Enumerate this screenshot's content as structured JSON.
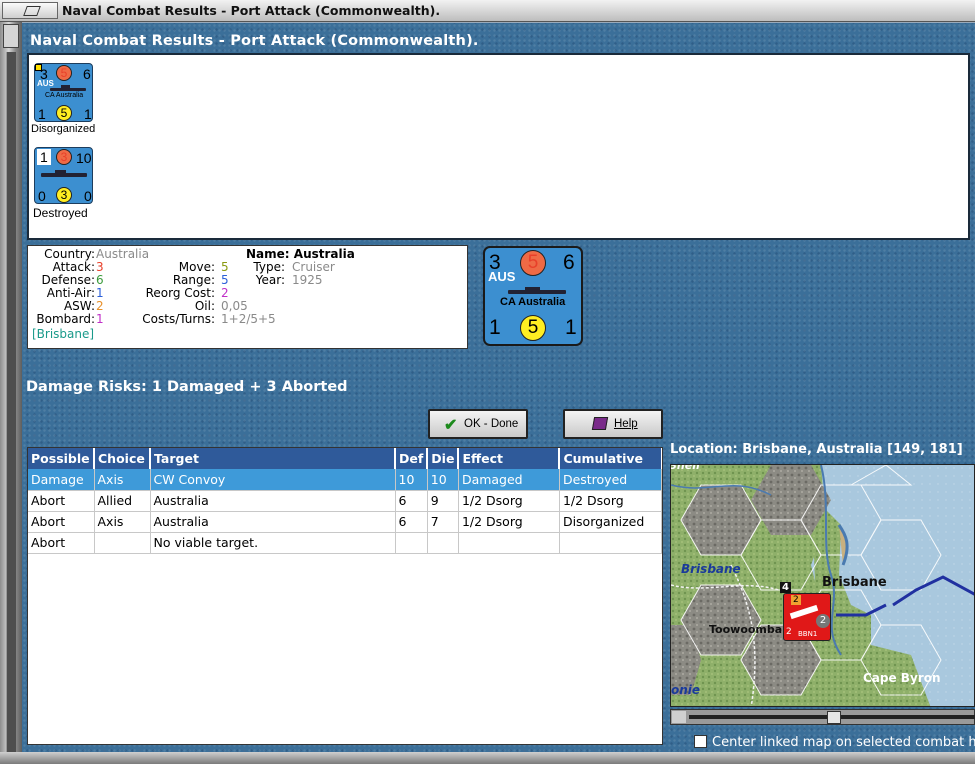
{
  "window": {
    "title": "Naval Combat Results - Port Attack (Commonwealth)."
  },
  "heading": "Naval Combat Results - Port Attack (Commonwealth).",
  "units": [
    {
      "nation": "AUS",
      "name": "CA Australia",
      "attack": "3",
      "defense_circle": "5",
      "range": "6",
      "bottom_left": "1",
      "bottom_circle": "5",
      "bottom_right": "1",
      "status": "Disorganized"
    },
    {
      "attack": "1",
      "defense_circle": "3",
      "range": "10",
      "bottom_left": "0",
      "bottom_circle": "3",
      "bottom_right": "0",
      "status": "Destroyed"
    }
  ],
  "info": {
    "country_label": "Country:",
    "country": "Australia",
    "attack_label": "Attack:",
    "attack": "3",
    "defense_label": "Defense:",
    "defense": "6",
    "antiair_label": "Anti-Air:",
    "antiair": "1",
    "asw_label": "ASW:",
    "asw": "2",
    "bombard_label": "Bombard:",
    "bombard": "1",
    "location": "[Brisbane]",
    "move_label": "Move:",
    "move": "5",
    "range_label": "Range:",
    "range": "5",
    "reorg_label": "Reorg Cost:",
    "reorg": "2",
    "oil_label": "Oil:",
    "oil": "0,05",
    "costs_label": "Costs/Turns:",
    "costs": "1+2/5+5",
    "name_label": "Name:",
    "name": "Australia",
    "type_label": "Type:",
    "type": "Cruiser",
    "year_label": "Year:",
    "year": "1925"
  },
  "big_counter": {
    "attack": "3",
    "defense_circle": "5",
    "range": "6",
    "nation": "AUS",
    "name": "CA Australia",
    "bottom_left": "1",
    "bottom_circle": "5",
    "bottom_right": "1"
  },
  "damage_risks": "Damage Risks: 1 Damaged + 3 Aborted",
  "buttons": {
    "ok": "OK - Done",
    "help": "Help"
  },
  "table": {
    "headers": [
      "Possible",
      "Choice",
      "Target",
      "Def",
      "Die",
      "Effect",
      "Cumulative"
    ],
    "rows": [
      [
        "Damage",
        "Axis",
        "CW Convoy",
        "10",
        "10",
        "Damaged",
        "Destroyed"
      ],
      [
        "Abort",
        "Allied",
        "Australia",
        "6",
        "9",
        "1/2 Dsorg",
        "1/2 Dsorg"
      ],
      [
        "Abort",
        "Axis",
        "Australia",
        "6",
        "7",
        "1/2 Dsorg",
        "Disorganized"
      ],
      [
        "Abort",
        "",
        "No viable target.",
        "",
        "",
        "",
        ""
      ]
    ]
  },
  "location": "Location:  Brisbane, Australia [149, 181]",
  "map": {
    "labels": {
      "brisbane_city": "Brisbane",
      "brisbane_region": "Brisbane",
      "toowoomba": "Toowoomba",
      "cape_byron": "Cape Byron",
      "partial_top": "Snell",
      "partial_bottom": "onie"
    },
    "stack": {
      "count": "4",
      "top": "2",
      "mid": "2",
      "circle": "2",
      "bottom_left": "2",
      "code": "BBN1"
    }
  },
  "center_option": "Center linked map on selected combat h"
}
